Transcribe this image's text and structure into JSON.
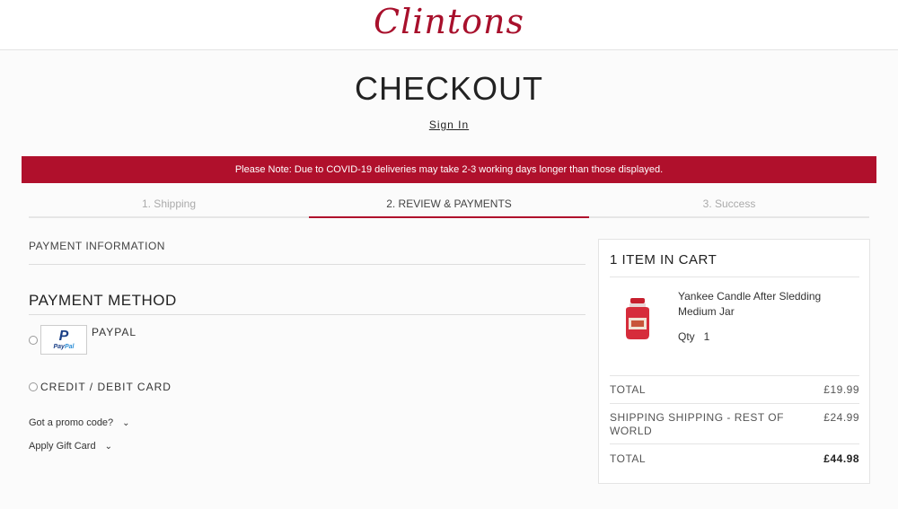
{
  "header": {
    "logo": "Clintons"
  },
  "page": {
    "title": "CHECKOUT",
    "sign_in": "Sign In"
  },
  "notice": "Please Note: Due to COVID-19 deliveries may take 2-3 working days longer than those displayed.",
  "steps": [
    {
      "label": "1. Shipping",
      "active": false
    },
    {
      "label": "2. REVIEW & PAYMENTS",
      "active": true
    },
    {
      "label": "3. Success",
      "active": false
    }
  ],
  "payment": {
    "info_heading": "PAYMENT INFORMATION",
    "method_heading": "PAYMENT METHOD",
    "paypal_label": "PAYPAL",
    "paypal_logo_text": "PayPal",
    "card_label": "CREDIT / DEBIT CARD",
    "promo_toggle": "Got a promo code?",
    "gift_toggle": "Apply Gift Card"
  },
  "cart": {
    "title": "1 ITEM IN CART",
    "item": {
      "name": "Yankee Candle After Sledding Medium Jar",
      "qty_label": "Qty",
      "qty": "1"
    },
    "totals": [
      {
        "label": "TOTAL",
        "value": "£19.99"
      },
      {
        "label": "SHIPPING SHIPPING - REST OF WORLD",
        "value": "£24.99"
      },
      {
        "label": "TOTAL",
        "value": "£44.98"
      }
    ]
  },
  "colors": {
    "brand": "#b0102c",
    "background": "#fbfbfb"
  }
}
